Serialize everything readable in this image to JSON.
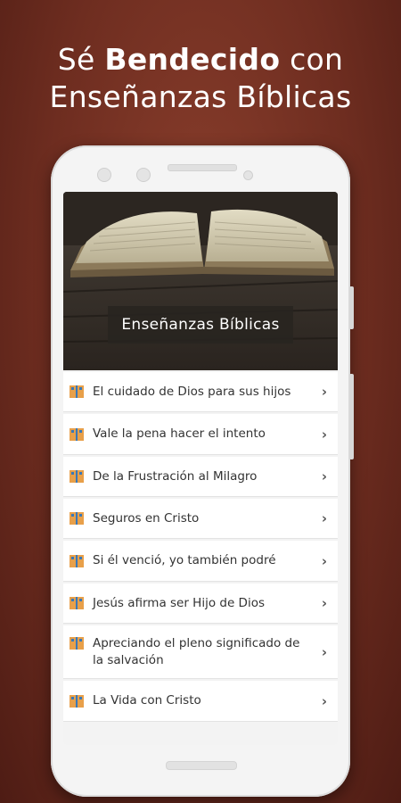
{
  "headline": {
    "line1_pre": "Sé ",
    "line1_bold": "Bendecido",
    "line1_post": " con",
    "line2": "Enseñanzas Bíblicas"
  },
  "banner": {
    "title": "Enseñanzas Bíblicas"
  },
  "items": [
    {
      "label": "El cuidado de Dios para sus hijos"
    },
    {
      "label": "Vale la pena hacer el intento"
    },
    {
      "label": "De la Frustración al Milagro"
    },
    {
      "label": "Seguros en Cristo"
    },
    {
      "label": "Si él venció, yo también podré"
    },
    {
      "label": "Jesús afirma ser Hijo de Dios"
    },
    {
      "label": "Apreciando el pleno significado de la salvación"
    },
    {
      "label": "La Vida con Cristo"
    }
  ],
  "colors": {
    "background": "#7a3424",
    "icon_orange": "#e8a04a",
    "icon_blue": "#3a79b8"
  },
  "icons": {
    "item_icon": "book-icon",
    "chevron": "chevron-right-icon"
  }
}
